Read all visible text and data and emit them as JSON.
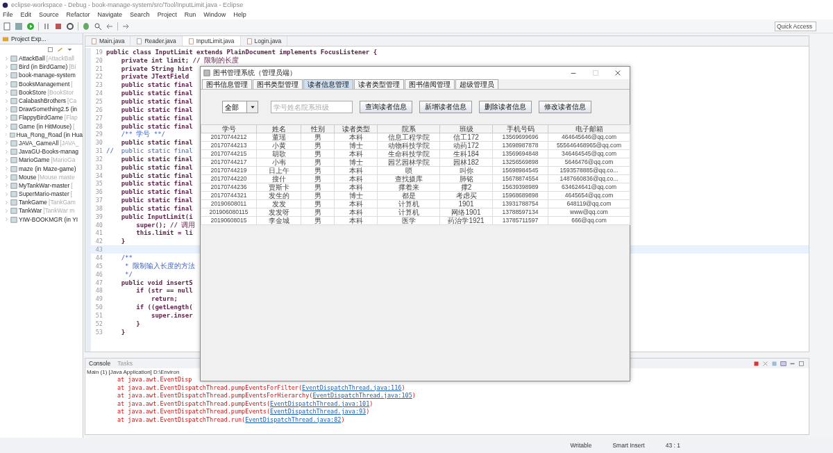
{
  "window": {
    "title": "eclipse-workspace - Debug - book-manage-system/src/Tool/InputLimit.java - Eclipse"
  },
  "menu": [
    "File",
    "Edit",
    "Source",
    "Refactor",
    "Navigate",
    "Search",
    "Project",
    "Run",
    "Window",
    "Help"
  ],
  "quick_access": {
    "placeholder": "Quick Access"
  },
  "project_explorer": {
    "title": "Project Exp...",
    "items": [
      {
        "name": "AttackBall",
        "detail": "[AttackBall"
      },
      {
        "name": "Bird (in BirdGame)",
        "detail": "[Bi"
      },
      {
        "name": "book-manage-system"
      },
      {
        "name": "BooksManagement",
        "detail": "["
      },
      {
        "name": "BookStore",
        "detail": "[BookStor"
      },
      {
        "name": "CalabashBrothers",
        "detail": "[Ca"
      },
      {
        "name": "DrawSomething2.5 (in"
      },
      {
        "name": "FlappyBirdGame",
        "detail": "[Flap"
      },
      {
        "name": "Game (in HitMouse)",
        "detail": "["
      },
      {
        "name": "Hua_Rong_Road (in Hua"
      },
      {
        "name": "JAVA_GameAll",
        "detail": "[JAVA_"
      },
      {
        "name": "JavaGU-Books-manag"
      },
      {
        "name": "MarioGame",
        "detail": "[MarioGa"
      },
      {
        "name": "maze (in Maze-game)"
      },
      {
        "name": "Mouse",
        "detail": "[Mouse maste"
      },
      {
        "name": "MyTankWar-master",
        "detail": "["
      },
      {
        "name": "SuperMario-master",
        "detail": "["
      },
      {
        "name": "TankGame",
        "detail": "[TankGam"
      },
      {
        "name": "TankWar",
        "detail": "[TankWar m"
      },
      {
        "name": "YIW-BOOKMGR (in YI"
      }
    ]
  },
  "editor": {
    "tabs": [
      {
        "label": "Main.java",
        "selected": false
      },
      {
        "label": "Reader.java",
        "selected": false
      },
      {
        "label": "InputLimit.java",
        "selected": true
      },
      {
        "label": "Login.java",
        "selected": false
      }
    ],
    "lines": [
      {
        "n": "19",
        "text": "public class InputLimit extends PlainDocument implements FocusListener {",
        "kind": "code"
      },
      {
        "n": "20",
        "text": "    private int limit; // 限制的长度",
        "kind": "code"
      },
      {
        "n": "21",
        "text": "    private String hint",
        "kind": "code"
      },
      {
        "n": "22",
        "text": "    private JTextField",
        "kind": "code"
      },
      {
        "n": "23",
        "text": "    public static final",
        "kind": "code"
      },
      {
        "n": "24",
        "text": "    public static final",
        "kind": "code"
      },
      {
        "n": "25",
        "text": "    public static final",
        "kind": "code"
      },
      {
        "n": "26",
        "text": "    public static final",
        "kind": "code"
      },
      {
        "n": "27",
        "text": "    public static final",
        "kind": "code"
      },
      {
        "n": "28",
        "text": "    public static final",
        "kind": "code"
      },
      {
        "n": "29",
        "text": "    /** 学号 **/",
        "kind": "comment"
      },
      {
        "n": "30",
        "text": "    public static final",
        "kind": "code"
      },
      {
        "n": "31",
        "text": "//  public static final",
        "kind": "comment"
      },
      {
        "n": "32",
        "text": "    public static final",
        "kind": "code"
      },
      {
        "n": "33",
        "text": "    public static final",
        "kind": "code"
      },
      {
        "n": "34",
        "text": "    public static final",
        "kind": "code"
      },
      {
        "n": "35",
        "text": "    public static final",
        "kind": "code"
      },
      {
        "n": "36",
        "text": "    public static final",
        "kind": "code"
      },
      {
        "n": "37",
        "text": "    public static final",
        "kind": "code"
      },
      {
        "n": "38",
        "text": "    public static final",
        "kind": "code"
      },
      {
        "n": "39",
        "text": "    public InputLimit(i",
        "kind": "code"
      },
      {
        "n": "40",
        "text": "        super(); // 调用",
        "kind": "code"
      },
      {
        "n": "41",
        "text": "        this.limit = li",
        "kind": "code"
      },
      {
        "n": "42",
        "text": "    }",
        "kind": "code"
      },
      {
        "n": "43",
        "kind": "current"
      },
      {
        "n": "44",
        "text": "    /**",
        "kind": "comment"
      },
      {
        "n": "45",
        "text": "     * 限制输入长度的方法",
        "kind": "comment"
      },
      {
        "n": "46",
        "text": "     */",
        "kind": "comment"
      },
      {
        "n": "47",
        "text": "    public void insertS",
        "kind": "code"
      },
      {
        "n": "48",
        "text": "        if (str == null",
        "kind": "code"
      },
      {
        "n": "49",
        "text": "            return;",
        "kind": "code"
      },
      {
        "n": "50",
        "text": "        if ((getLength(",
        "kind": "code"
      },
      {
        "n": "51",
        "text": "            super.inser",
        "kind": "code"
      },
      {
        "n": "52",
        "text": "        }",
        "kind": "code"
      },
      {
        "n": "53",
        "text": "    }",
        "kind": "code"
      }
    ]
  },
  "console": {
    "tabs": [
      {
        "label": "Console",
        "selected": true
      },
      {
        "label": "Tasks",
        "selected": false
      }
    ],
    "description": "Main (1) [Java Application] D:\\Environ",
    "lines": [
      {
        "prefix": "at java.awt.EventDisp"
      },
      {
        "prefix": "at java.awt.EventDispatchThread.pumpEventsForFilter(",
        "link": "EventDispatchThread.java:116",
        "suffix": ")"
      },
      {
        "prefix": "at java.awt.EventDispatchThread.pumpEventsForHierarchy(",
        "link": "EventDispatchThread.java:105",
        "suffix": ")"
      },
      {
        "prefix": "at java.awt.EventDispatchThread.pumpEvents(",
        "link": "EventDispatchThread.java:101",
        "suffix": ")"
      },
      {
        "prefix": "at java.awt.EventDispatchThread.pumpEvents(",
        "link": "EventDispatchThread.java:93",
        "suffix": ")"
      },
      {
        "prefix": "at java.awt.EventDispatchThread.run(",
        "link": "EventDispatchThread.java:82",
        "suffix": ")"
      }
    ]
  },
  "status_bar": [
    "Writable",
    "Smart Insert",
    "43 : 1"
  ],
  "dialog": {
    "title": "图书管理系统（管理员端）",
    "tabs": [
      {
        "label": "图书信息管理",
        "selected": false
      },
      {
        "label": "图书类型管理",
        "selected": false
      },
      {
        "label": "读者信息管理",
        "selected": true
      },
      {
        "label": "读者类型管理",
        "selected": false
      },
      {
        "label": "图书借阅管理",
        "selected": false
      },
      {
        "label": "超级管理员",
        "selected": false
      }
    ],
    "filter": {
      "value": "全部"
    },
    "search": {
      "placeholder": "学号姓名院系班级"
    },
    "buttons": [
      "查询读者信息",
      "新增读者信息",
      "删除读者信息",
      "修改读者信息"
    ],
    "table": {
      "columns": [
        "学号",
        "姓名",
        "性别",
        "读者类型",
        "院系",
        "班级",
        "手机号码",
        "电子邮箱"
      ],
      "rows": [
        [
          "20170744212",
          "董瑶",
          "男",
          "本科",
          "信息工程学院",
          "信工172",
          "13569699696",
          "464645646@qq.com"
        ],
        [
          "20170744213",
          "小黄",
          "男",
          "博士",
          "动物科技学院",
          "动药172",
          "13698987878",
          "555646468965@qq.com"
        ],
        [
          "20170744215",
          "胡歌",
          "男",
          "本科",
          "生命科技学院",
          "生科184",
          "13569694848",
          "346464545@qq.com"
        ],
        [
          "20170744217",
          "小韦",
          "男",
          "博士",
          "园艺园林学院",
          "园林182",
          "13256569898",
          "5646476@qq.com"
        ],
        [
          "20170744219",
          "日上午",
          "男",
          "本科",
          "唢",
          "叫你",
          "15698984545",
          "1593578885@qq.co..."
        ],
        [
          "20170744220",
          "搜什",
          "男",
          "本科",
          "查找摄库",
          "肺铭",
          "15678874554",
          "1487660836@qq.co..."
        ],
        [
          "20170744236",
          "贾斯卡",
          "男",
          "本科",
          "撑着来",
          "撑2",
          "15639398989",
          "634624641@qq.com"
        ],
        [
          "20170744321",
          "发生的",
          "男",
          "博士",
          "都是",
          "考虑买",
          "15968689898",
          "4645654@qq.com"
        ],
        [
          "20190608011",
          "发发",
          "男",
          "本科",
          "计算机",
          "1901",
          "13931788754",
          "648119@qq.com"
        ],
        [
          "201906080115",
          "发发呀",
          "男",
          "本科",
          "计算机",
          "网络1901",
          "13788597134",
          "www@qq.com"
        ],
        [
          "20190608015",
          "李金城",
          "男",
          "本科",
          "医学",
          "药治学1921",
          "13785711597",
          "666@qq.com"
        ]
      ]
    }
  }
}
